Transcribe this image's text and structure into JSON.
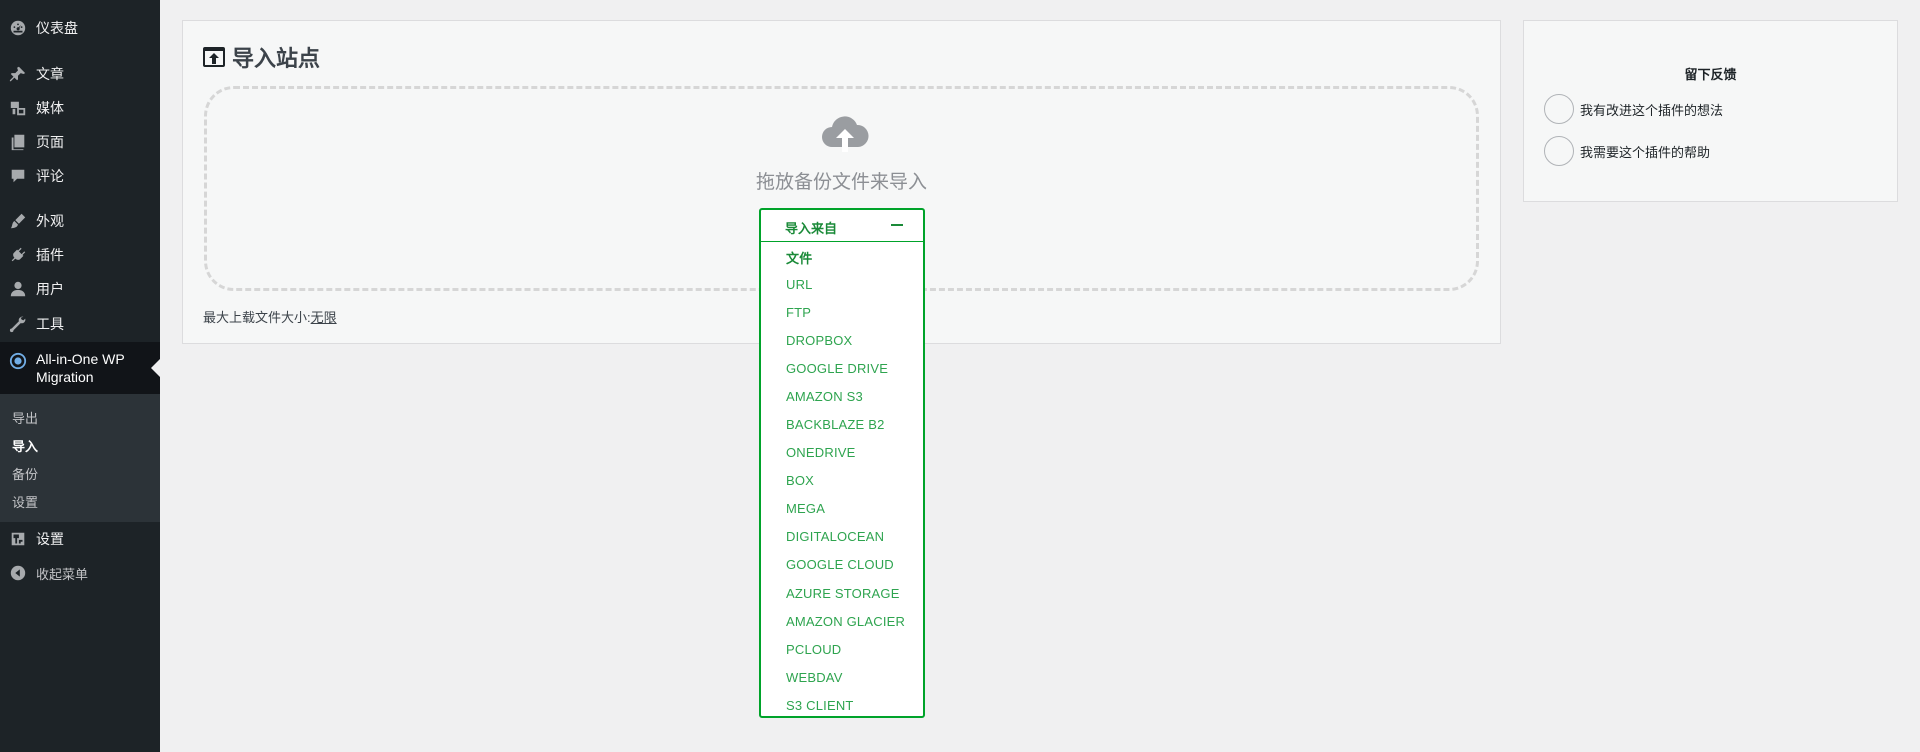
{
  "sidebar": {
    "items": [
      {
        "label": "仪表盘",
        "icon": "dashboard-icon"
      },
      {
        "label": "文章",
        "icon": "pin-icon"
      },
      {
        "label": "媒体",
        "icon": "media-icon"
      },
      {
        "label": "页面",
        "icon": "pages-icon"
      },
      {
        "label": "评论",
        "icon": "comments-icon"
      },
      {
        "label": "外观",
        "icon": "appearance-brush-icon"
      },
      {
        "label": "插件",
        "icon": "plugins-icon"
      },
      {
        "label": "用户",
        "icon": "users-icon"
      },
      {
        "label": "工具",
        "icon": "tools-wrench-icon"
      }
    ],
    "active": {
      "label": "All-in-One WP Migration",
      "icon": "migration-icon"
    },
    "submenu": [
      {
        "label": "导出",
        "current": false
      },
      {
        "label": "导入",
        "current": true
      },
      {
        "label": "备份",
        "current": false
      },
      {
        "label": "设置",
        "current": false
      }
    ],
    "bottom_items": [
      {
        "label": "设置",
        "icon": "settings-icon"
      },
      {
        "label": "收起菜单",
        "icon": "collapse-icon"
      }
    ]
  },
  "import": {
    "title": "导入站点",
    "drop_text": "拖放备份文件来导入",
    "upload_limit_prefix": "最大上载文件大小:",
    "upload_limit_link": "无限",
    "dropdown": {
      "label": "导入来自",
      "options": [
        "文件",
        "URL",
        "FTP",
        "DROPBOX",
        "GOOGLE DRIVE",
        "AMAZON S3",
        "BACKBLAZE B2",
        "ONEDRIVE",
        "BOX",
        "MEGA",
        "DIGITALOCEAN",
        "GOOGLE CLOUD",
        "AZURE STORAGE",
        "AMAZON GLACIER",
        "PCLOUD",
        "WEBDAV",
        "S3 CLIENT"
      ]
    }
  },
  "feedback": {
    "title": "留下反馈",
    "options": [
      "我有改进这个插件的想法",
      "我需要这个插件的帮助"
    ]
  },
  "colors": {
    "sidebar_bg": "#1d2327",
    "submenu_bg": "#2c3338",
    "accent_green": "#00a32a",
    "page_bg": "#f0f0f1"
  }
}
